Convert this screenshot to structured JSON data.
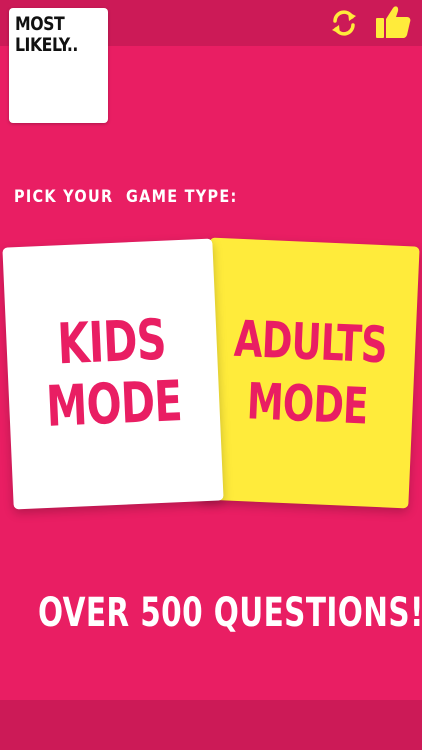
{
  "app": {
    "logo_line1": "MOST",
    "logo_line2": "LIKELY.."
  },
  "header": {
    "refresh_icon": "refresh-icon",
    "like_icon": "thumbs-up-icon"
  },
  "main": {
    "pick_label": "PICK YOUR  GAME TYPE:",
    "kids_card": {
      "line1": "KIDS",
      "line2": "MODE"
    },
    "adults_card": {
      "line1": "ADULTS",
      "line2": "MODE"
    },
    "promo": "OVER 500 QUESTIONS!"
  },
  "colors": {
    "background": "#e91e63",
    "bar": "#cc1a57",
    "accent_yellow": "#ffeb3b",
    "card_white": "#ffffff"
  }
}
